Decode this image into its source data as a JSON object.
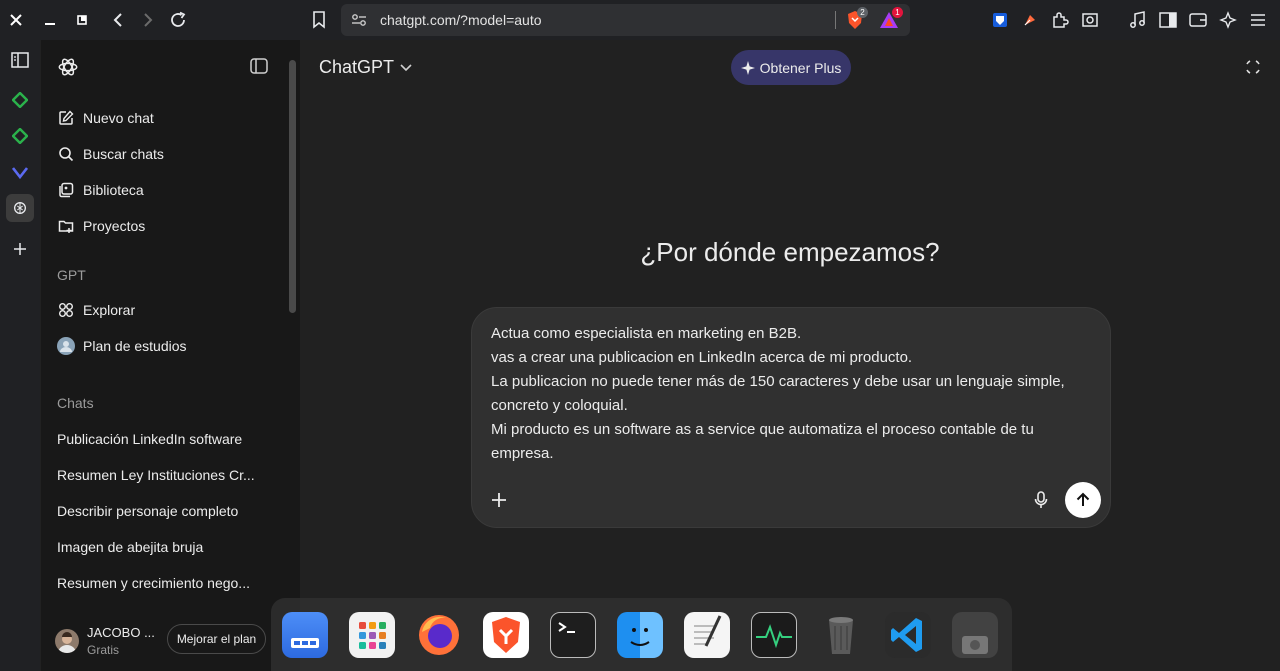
{
  "browser": {
    "url": "chatgpt.com/?model=auto",
    "brave_badge": "2",
    "rewards_badge": "1"
  },
  "sidebar": {
    "nav": [
      {
        "label": "Nuevo chat",
        "icon": "edit-icon"
      },
      {
        "label": "Buscar chats",
        "icon": "search-icon"
      },
      {
        "label": "Biblioteca",
        "icon": "library-icon"
      },
      {
        "label": "Proyectos",
        "icon": "folder-plus-icon"
      }
    ],
    "gpt_section": "GPT",
    "gpts": [
      {
        "label": "Explorar",
        "icon": "grid-icon"
      },
      {
        "label": "Plan de estudios",
        "icon": "gpt-avatar"
      }
    ],
    "chats_section": "Chats",
    "chats": [
      "Publicación LinkedIn software",
      "Resumen Ley Instituciones Cr...",
      "Describir personaje completo",
      "Imagen de abejita bruja",
      "Resumen y crecimiento nego..."
    ]
  },
  "user": {
    "name": "JACOBO ...",
    "plan": "Gratis",
    "upgrade_label": "Mejorar el plan"
  },
  "header": {
    "model": "ChatGPT",
    "plus_label": "Obtener Plus"
  },
  "main": {
    "headline": "¿Por dónde empezamos?",
    "prompt": "Actua como especialista en marketing en B2B.\nvas a crear una publicacion en LinkedIn acerca de mi producto.\nLa publicacion no puede tener más de 150 caracteres y debe usar un lenguaje simple,\nconcreto y coloquial.\nMi producto es un software as a service que automatiza el proceso contable de tu\nempresa."
  },
  "dock": [
    "files",
    "app-grid",
    "firefox",
    "brave",
    "terminal",
    "finder",
    "text-editor",
    "system-monitor",
    "trash",
    "vscode",
    "screenshot"
  ]
}
